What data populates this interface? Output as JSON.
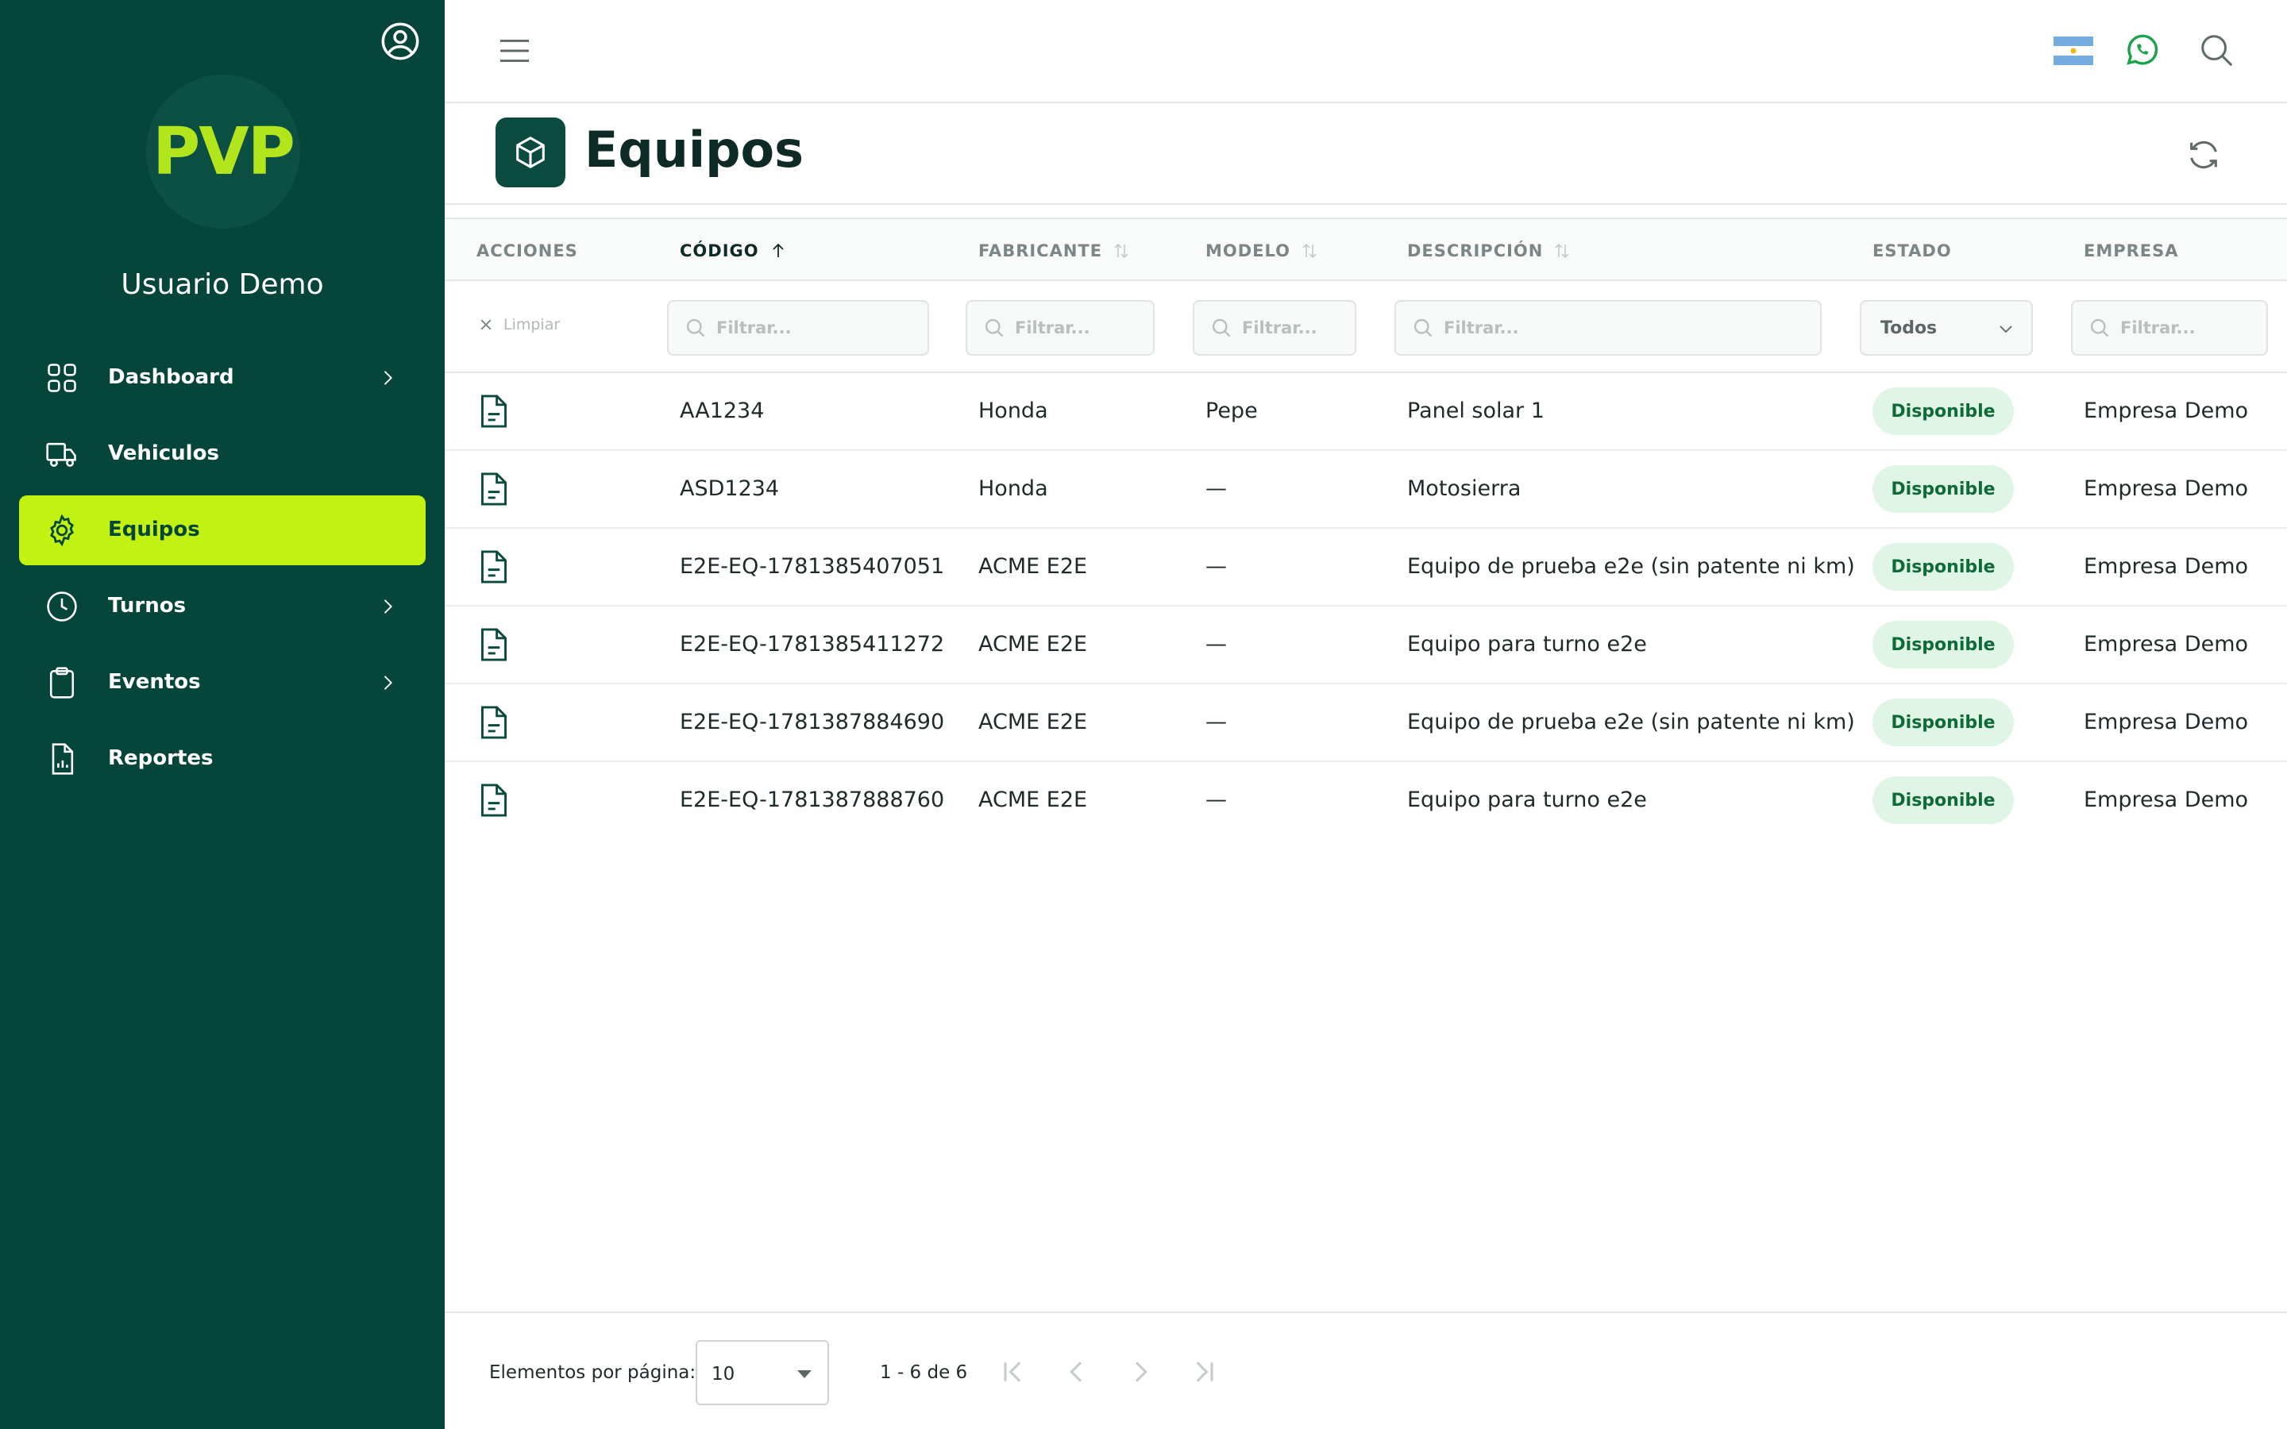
{
  "sidebar": {
    "logo_text": "PVP",
    "user_name": "Usuario Demo",
    "items": [
      {
        "label": "Dashboard",
        "icon": "grid-icon",
        "has_chevron": true,
        "active": false
      },
      {
        "label": "Vehiculos",
        "icon": "truck-icon",
        "has_chevron": false,
        "active": false
      },
      {
        "label": "Equipos",
        "icon": "gear-icon",
        "has_chevron": false,
        "active": true
      },
      {
        "label": "Turnos",
        "icon": "clock-icon",
        "has_chevron": true,
        "active": false
      },
      {
        "label": "Eventos",
        "icon": "clipboard-icon",
        "has_chevron": true,
        "active": false
      },
      {
        "label": "Reportes",
        "icon": "report-icon",
        "has_chevron": false,
        "active": false
      }
    ]
  },
  "page": {
    "title": "Equipos"
  },
  "table": {
    "columns": {
      "acciones": "ACCIONES",
      "codigo": "CÓDIGO",
      "fabricante": "FABRICANTE",
      "modelo": "MODELO",
      "descripcion": "DESCRIPCIÓN",
      "estado": "ESTADO",
      "empresa": "EMPRESA"
    },
    "filters": {
      "clear_label": "Limpiar",
      "placeholder": "Filtrar...",
      "estado_selected": "Todos"
    },
    "rows": [
      {
        "codigo": "AA1234",
        "fabricante": "Honda",
        "modelo": "Pepe",
        "descripcion": "Panel solar 1",
        "estado": "Disponible",
        "empresa": "Empresa Demo"
      },
      {
        "codigo": "ASD1234",
        "fabricante": "Honda",
        "modelo": "—",
        "descripcion": "Motosierra",
        "estado": "Disponible",
        "empresa": "Empresa Demo"
      },
      {
        "codigo": "E2E-EQ-1781385407051",
        "fabricante": "ACME E2E",
        "modelo": "—",
        "descripcion": "Equipo de prueba e2e (sin patente ni km)",
        "estado": "Disponible",
        "empresa": "Empresa Demo"
      },
      {
        "codigo": "E2E-EQ-1781385411272",
        "fabricante": "ACME E2E",
        "modelo": "—",
        "descripcion": "Equipo para turno e2e",
        "estado": "Disponible",
        "empresa": "Empresa Demo"
      },
      {
        "codigo": "E2E-EQ-1781387884690",
        "fabricante": "ACME E2E",
        "modelo": "—",
        "descripcion": "Equipo de prueba e2e (sin patente ni km)",
        "estado": "Disponible",
        "empresa": "Empresa Demo"
      },
      {
        "codigo": "E2E-EQ-1781387888760",
        "fabricante": "ACME E2E",
        "modelo": "—",
        "descripcion": "Equipo para turno e2e",
        "estado": "Disponible",
        "empresa": "Empresa Demo"
      }
    ]
  },
  "paginator": {
    "per_page_label": "Elementos por página:",
    "per_page_value": "10",
    "range_label": "1 - 6 de 6"
  },
  "colors": {
    "sidebar_bg": "#05453a",
    "accent": "#c1f211",
    "status_bg": "#dff5e6",
    "status_text": "#0e6b35"
  }
}
